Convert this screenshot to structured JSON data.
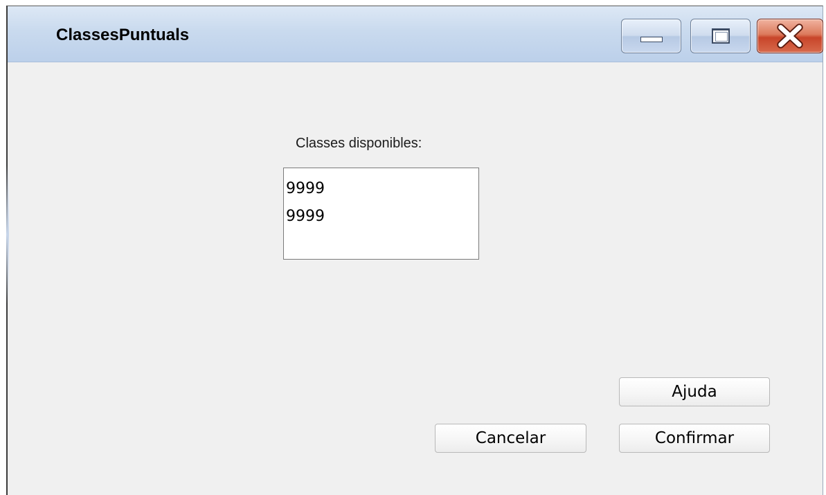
{
  "window": {
    "title": "ClassesPuntuals"
  },
  "titlebar_buttons": {
    "minimize_icon": "minimize-icon",
    "maximize_icon": "maximize-icon",
    "close_icon": "close-icon",
    "close_color": "#c8452a"
  },
  "main": {
    "list_label": "Classes disponibles:",
    "classes": [
      "9999",
      "9999"
    ]
  },
  "buttons": {
    "help": "Ajuda",
    "cancel": "Cancelar",
    "confirm": "Confirmar"
  }
}
